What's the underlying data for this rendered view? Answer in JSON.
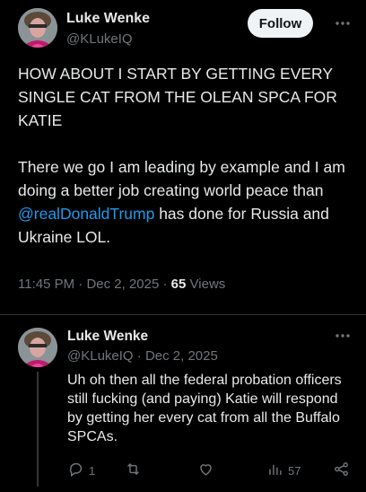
{
  "main_tweet": {
    "author_name": "Luke Wenke",
    "author_handle": "@KLukeIQ",
    "follow_label": "Follow",
    "text_part1": "HOW ABOUT I START BY GETTING EVERY SINGLE CAT FROM THE OLEAN SPCA FOR KATIE\n\nThere we go I am leading by example and I am doing a better job creating world peace than ",
    "mention": "@realDonaldTrump",
    "text_part2": " has done for Russia and Ukraine LOL.",
    "time": "11:45 PM",
    "date": "Dec 2, 2025",
    "separator": "·",
    "views_count": "65",
    "views_label": "Views"
  },
  "reply": {
    "author_name": "Luke Wenke",
    "author_handle": "@KLukeIQ",
    "date": "Dec 2, 2025",
    "separator": "·",
    "text": "Uh oh then all the federal probation officers still fucking (and paying) Katie will respond by getting her every cat from all the Buffalo SPCAs.",
    "reply_count": "1",
    "repost_count": "",
    "like_count": "",
    "views_count": "57"
  },
  "icons": {
    "more": "more-icon",
    "reply": "reply-icon",
    "repost": "repost-icon",
    "like": "heart-icon",
    "views": "views-icon",
    "share": "share-icon"
  },
  "colors": {
    "background": "#000000",
    "text": "#e7e9ea",
    "muted": "#71767b",
    "link": "#1d9bf0",
    "follow_bg": "#eff3f4",
    "divider": "#2f3336"
  }
}
